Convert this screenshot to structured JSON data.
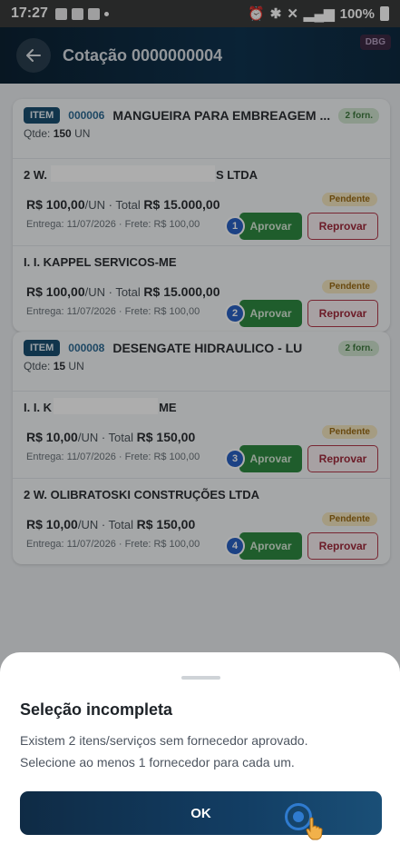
{
  "status_bar": {
    "time": "17:27",
    "battery": "100%"
  },
  "header": {
    "title": "Cotação 0000000004",
    "dbg": "DBG"
  },
  "items": [
    {
      "tag": "ITEM",
      "code": "000006",
      "name": "MANGUEIRA PARA EMBREAGEM ...",
      "forn_badge": "2 forn.",
      "qtde_label": "Qtde:",
      "qtde_value": "150",
      "qtde_unit": "UN",
      "suppliers": [
        {
          "name_start": "2 W.",
          "name_end": "S LTDA",
          "price": "R$ 100,00",
          "unit": "/UN",
          "total_label": "Total",
          "total": "R$ 15.000,00",
          "status": "Pendente",
          "meta": "Entrega: 11/07/2026 · Frete: R$ 100,00",
          "badge": "1",
          "approve": "Aprovar",
          "reject": "Reprovar"
        },
        {
          "name_start": "I. I. KAPPEL SERVICOS-ME",
          "name_end": "",
          "price": "R$ 100,00",
          "unit": "/UN",
          "total_label": "Total",
          "total": "R$ 15.000,00",
          "status": "Pendente",
          "meta": "Entrega: 11/07/2026 · Frete: R$ 100,00",
          "badge": "2",
          "approve": "Aprovar",
          "reject": "Reprovar"
        }
      ]
    },
    {
      "tag": "ITEM",
      "code": "000008",
      "name": "DESENGATE HIDRAULICO - LU",
      "forn_badge": "2 forn.",
      "qtde_label": "Qtde:",
      "qtde_value": "15",
      "qtde_unit": "UN",
      "suppliers": [
        {
          "name_start": "I. I. K",
          "name_end": "ME",
          "price": "R$ 10,00",
          "unit": "/UN",
          "total_label": "Total",
          "total": "R$ 150,00",
          "status": "Pendente",
          "meta": "Entrega: 11/07/2026 · Frete: R$ 100,00",
          "badge": "3",
          "approve": "Aprovar",
          "reject": "Reprovar"
        },
        {
          "name_start": "2 W. OLIBRATOSKI CONSTRUÇÕES LTDA",
          "name_end": "",
          "price": "R$ 10,00",
          "unit": "/UN",
          "total_label": "Total",
          "total": "R$ 150,00",
          "status": "Pendente",
          "meta": "Entrega: 11/07/2026 · Frete: R$ 100,00",
          "badge": "4",
          "approve": "Aprovar",
          "reject": "Reprovar"
        }
      ]
    }
  ],
  "sheet": {
    "title": "Seleção incompleta",
    "line1": "Existem 2 itens/serviços sem fornecedor aprovado.",
    "line2": "Selecione ao menos 1 fornecedor para cada um.",
    "ok_label": "OK"
  },
  "colors": {
    "approve": "#2f8a42",
    "reject": "#b3384a",
    "header": "#0f3450",
    "badge": "#2a62c4"
  }
}
